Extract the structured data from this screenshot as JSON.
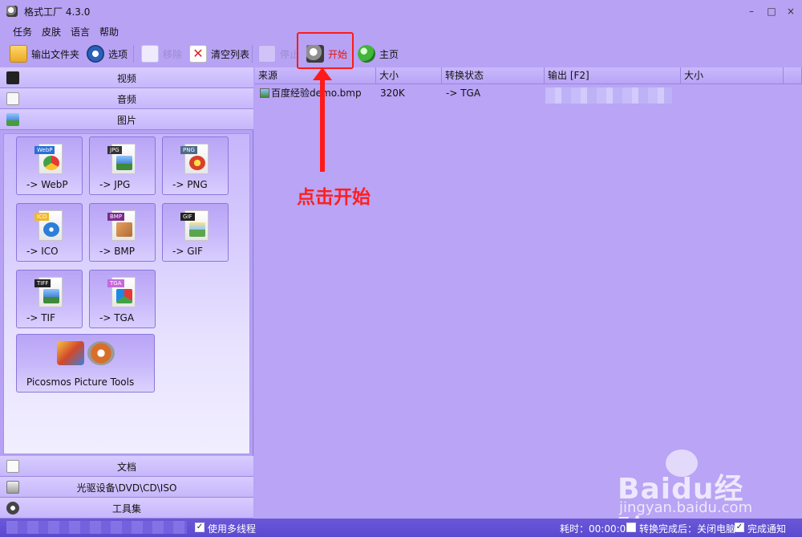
{
  "window": {
    "title": "格式工厂 4.3.0",
    "controls": [
      "–",
      "□",
      "×"
    ]
  },
  "menu": [
    "任务",
    "皮肤",
    "语言",
    "帮助"
  ],
  "toolbar": {
    "output_folder": "输出文件夹",
    "options": "选项",
    "remove": "移除",
    "clear_list": "清空列表",
    "stop": "停止",
    "start": "开始",
    "home": "主页"
  },
  "categories": {
    "video": "视频",
    "audio": "音频",
    "picture": "图片",
    "document": "文档",
    "rom": "光驱设备\\DVD\\CD\\ISO",
    "tools": "工具集"
  },
  "formats": [
    {
      "label": "-> WebP",
      "tag": "WebP"
    },
    {
      "label": "-> JPG",
      "tag": "JPG"
    },
    {
      "label": "-> PNG",
      "tag": "PNG"
    },
    {
      "label": "-> ICO",
      "tag": "ICO"
    },
    {
      "label": "-> BMP",
      "tag": "BMP"
    },
    {
      "label": "-> GIF",
      "tag": "GIF"
    },
    {
      "label": "-> TIF",
      "tag": "TIFF"
    },
    {
      "label": "-> TGA",
      "tag": "TGA"
    }
  ],
  "picosmos": "Picosmos Picture Tools",
  "table": {
    "headers": [
      "来源",
      "大小",
      "转换状态",
      "输出 [F2]",
      "大小"
    ],
    "rows": [
      {
        "source": "百度经验demo.bmp",
        "size": "320K",
        "status": "-> TGA"
      }
    ]
  },
  "annotation": "点击开始",
  "status": {
    "multithread": "使用多线程",
    "elapsed": "耗时：00:00:00",
    "after_convert": "转换完成后：关闭电脑",
    "notify": "完成通知"
  },
  "watermark": {
    "main": "Baidu经验",
    "sub": "jingyan.baidu.com"
  },
  "colors": {
    "accent": "#b8a3f5",
    "annotation": "#ff1a1a",
    "statusbar": "#5a4ad0"
  }
}
